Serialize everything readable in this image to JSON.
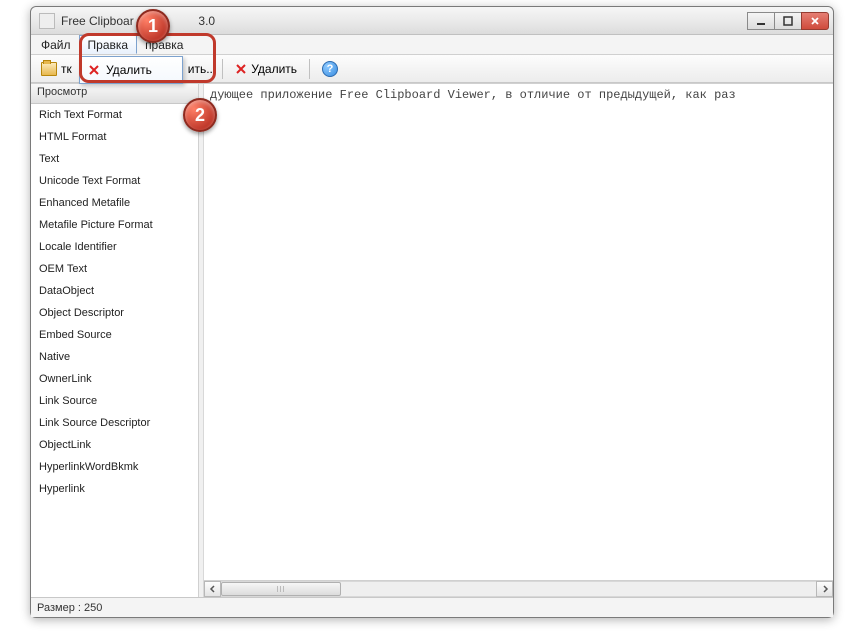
{
  "titlebar": {
    "app_title_visible_left": "Free Clipboar",
    "app_title_visible_right": "3.0"
  },
  "menubar": {
    "file": "Файл",
    "edit": "Правка",
    "help": "правка"
  },
  "toolbar": {
    "open_fragment": "тк",
    "delete_label": "Удалить",
    "save_fragment": "ить..."
  },
  "dropdown": {
    "delete_label": "Удалить"
  },
  "sidebar": {
    "header": "Просмотр",
    "items": [
      "Rich Text Format",
      "HTML Format",
      "Text",
      "Unicode Text Format",
      "Enhanced Metafile",
      "Metafile Picture Format",
      "Locale Identifier",
      "OEM Text",
      "DataObject",
      "Object Descriptor",
      "Embed Source",
      "Native",
      "OwnerLink",
      "Link Source",
      "Link Source Descriptor",
      "ObjectLink",
      "HyperlinkWordBkmk",
      "Hyperlink"
    ]
  },
  "document": {
    "text": "дующее приложение Free Clipboard Viewer, в отличие от предыдущей, как раз"
  },
  "statusbar": {
    "label": "Размер : 250"
  },
  "markers": {
    "m1": "1",
    "m2": "2"
  }
}
